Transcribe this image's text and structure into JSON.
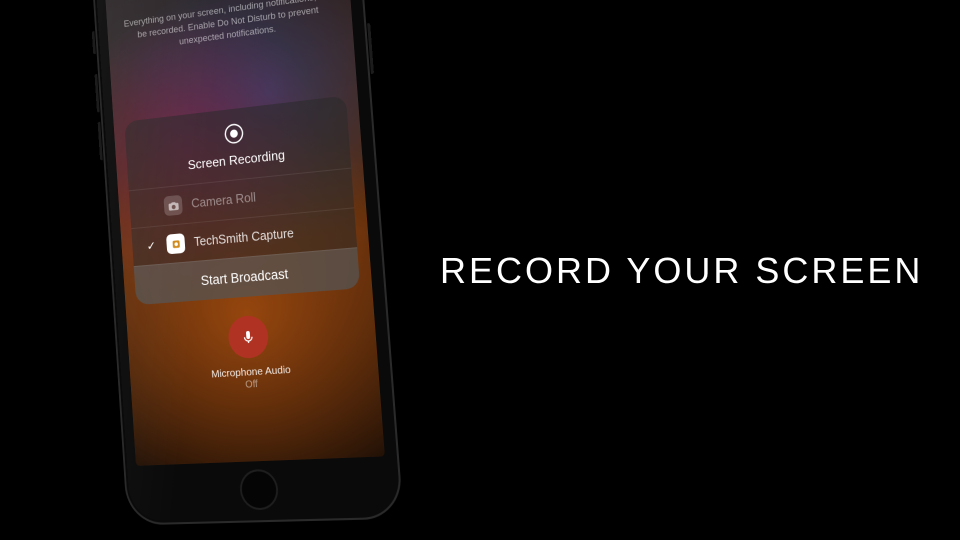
{
  "headline": "RECORD YOUR SCREEN",
  "info_text": "Everything on your screen, including notifications, will be recorded. Enable Do Not Disturb to prevent unexpected notifications.",
  "panel": {
    "title": "Screen Recording",
    "options": [
      {
        "label": "Camera Roll",
        "selected": false,
        "icon": "camera"
      },
      {
        "label": "TechSmith Capture",
        "selected": true,
        "icon": "techsmith"
      }
    ],
    "start_label": "Start Broadcast"
  },
  "mic": {
    "label": "Microphone Audio",
    "state": "Off"
  }
}
